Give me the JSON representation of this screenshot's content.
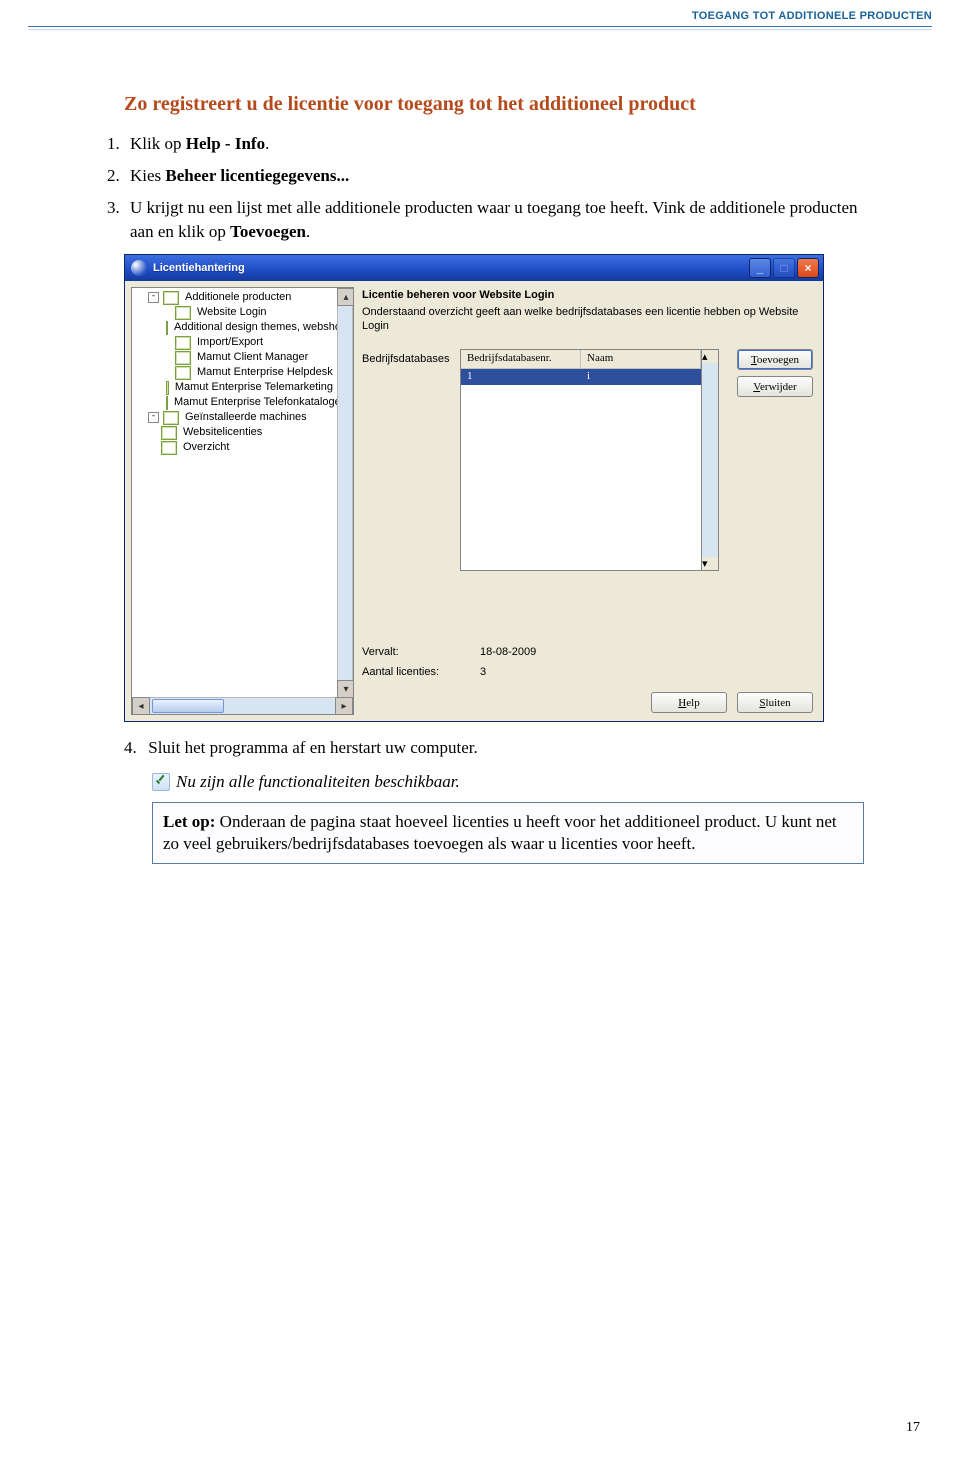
{
  "header": {
    "title": "TOEGANG TOT ADDITIONELE PRODUCTEN"
  },
  "section": {
    "title": "Zo registreert u de licentie voor toegang tot het additioneel product"
  },
  "steps": {
    "1a": "Klik op ",
    "1b": "Help - Info",
    "1c": ".",
    "2a": "Kies ",
    "2b": "Beheer licentiegegevens...",
    "3a": "U krijgt nu een lijst met alle additionele producten waar u toegang toe heeft. Vink de additionele producten aan en klik op ",
    "3b": "Toevoegen",
    "3c": "."
  },
  "step4": {
    "num": "4.",
    "text": "Sluit het programma af en herstart uw computer."
  },
  "note": {
    "text": "Nu zijn alle functionaliteiten beschikbaar."
  },
  "callout": {
    "lead": "Let op:",
    "text": " Onderaan de pagina staat hoeveel licenties u heeft voor het additioneel product. U kunt net zo veel gebruikers/bedrijfsdatabases toevoegen als waar u licenties voor heeft."
  },
  "pageNumber": "17",
  "xp": {
    "title": "Licentiehantering",
    "tree": {
      "root": "Additionele producten",
      "items": [
        "Website Login",
        "Additional design themes, webshop",
        "Import/Export",
        "Mamut Client Manager",
        "Mamut Enterprise Helpdesk",
        "Mamut Enterprise Telemarketing",
        "Mamut Enterprise Telefonkatalogen Be"
      ],
      "siblings": [
        "Geïnstalleerde machines",
        "Websitelicenties",
        "Overzicht"
      ]
    },
    "detail": {
      "title": "Licentie beheren voor Website Login",
      "sub": "Onderstaand overzicht geeft aan welke bedrijfsdatabases een licentie hebben op Website Login",
      "dbLabel": "Bedrijfsdatabases",
      "col1": "Bedrijfsdatabasenr.",
      "col2": "Naam",
      "rowNr": "1",
      "rowNaam": "i",
      "vervaltLabel": "Vervalt:",
      "vervaltVal": "18-08-2009",
      "aantalLabel": "Aantal licenties:",
      "aantalVal": "3"
    },
    "btns": {
      "toevoegen": "Toevoegen",
      "verwijder": "Verwijder",
      "help": "Help",
      "sluiten": "Sluiten"
    }
  }
}
